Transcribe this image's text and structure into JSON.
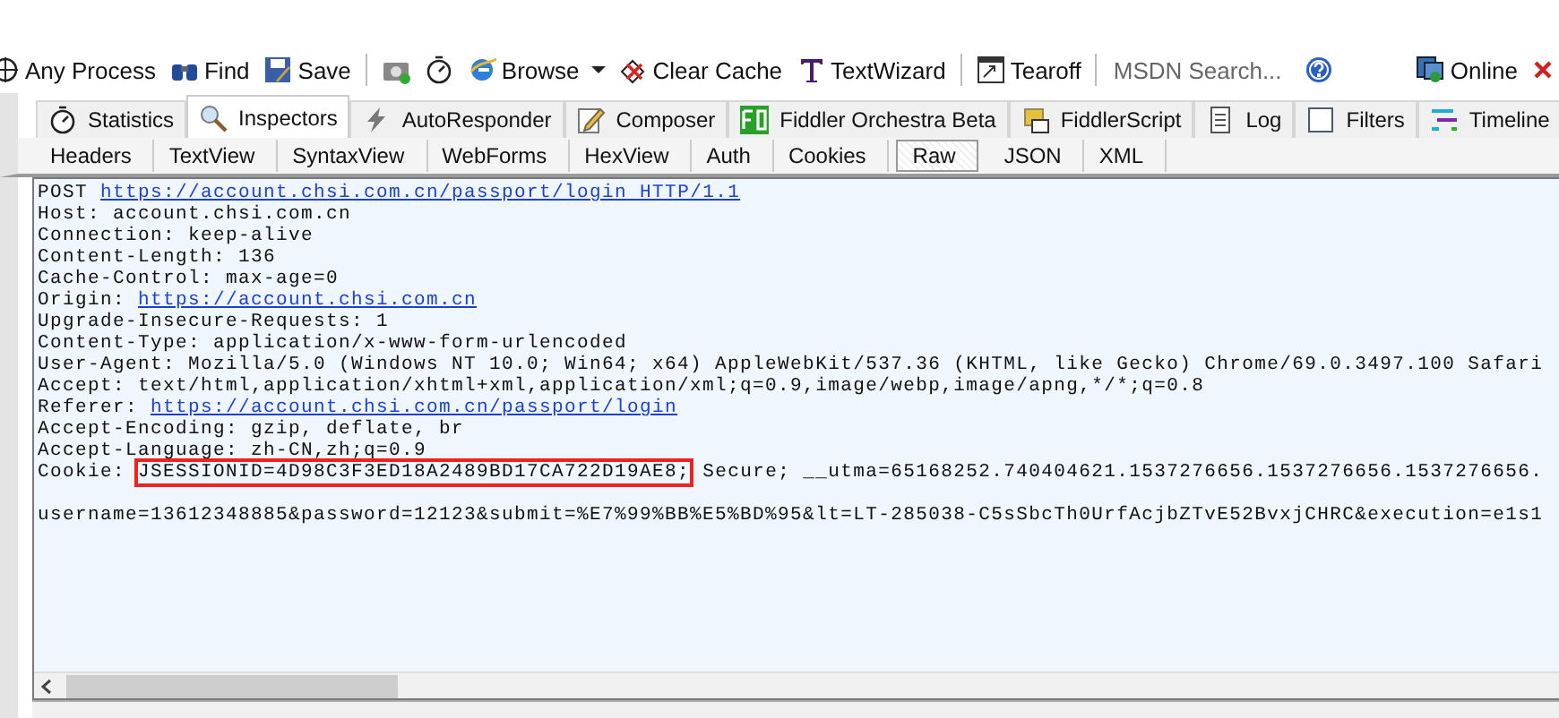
{
  "toolbar": {
    "items": [
      {
        "kind": "button",
        "label": "Any Process"
      },
      {
        "kind": "button",
        "label": "Find"
      },
      {
        "kind": "button",
        "label": "Save"
      },
      {
        "kind": "separator"
      },
      {
        "kind": "button"
      },
      {
        "kind": "button"
      },
      {
        "kind": "button",
        "label": "Browse"
      },
      {
        "kind": "dropdown"
      },
      {
        "kind": "button",
        "label": "Clear Cache"
      },
      {
        "kind": "button",
        "label": "TextWizard"
      },
      {
        "kind": "separator"
      },
      {
        "kind": "button",
        "label": "Tearoff"
      },
      {
        "kind": "separator"
      },
      {
        "kind": "search",
        "placeholder": "MSDN Search..."
      },
      {
        "kind": "button"
      },
      {
        "kind": "spacer"
      },
      {
        "kind": "button",
        "label": "Online"
      },
      {
        "kind": "close"
      }
    ]
  },
  "tabs": [
    {
      "label": "Statistics",
      "selected": false
    },
    {
      "label": "Inspectors",
      "selected": true
    },
    {
      "label": "AutoResponder",
      "selected": false
    },
    {
      "label": "Composer",
      "selected": false
    },
    {
      "label": "Fiddler Orchestra Beta",
      "selected": false
    },
    {
      "label": "FiddlerScript",
      "selected": false
    },
    {
      "label": "Log",
      "selected": false
    },
    {
      "label": "Filters",
      "selected": false
    },
    {
      "label": "Timeline",
      "selected": false
    }
  ],
  "inspector_tabs": [
    {
      "label": "Headers",
      "selected": false
    },
    {
      "label": "TextView",
      "selected": false
    },
    {
      "label": "SyntaxView",
      "selected": false
    },
    {
      "label": "WebForms",
      "selected": false
    },
    {
      "label": "HexView",
      "selected": false
    },
    {
      "label": "Auth",
      "selected": false
    },
    {
      "label": "Cookies",
      "selected": false
    },
    {
      "label": "Raw",
      "selected": true
    },
    {
      "label": "JSON",
      "selected": false
    },
    {
      "label": "XML",
      "selected": false
    }
  ],
  "raw_request": [
    {
      "kind": "line",
      "segments": [
        {
          "text": "POST ",
          "link": false
        },
        {
          "text": "https://account.chsi.com.cn/passport/login HTTP/1.1",
          "link": true
        }
      ]
    },
    {
      "kind": "line",
      "segments": [
        {
          "text": "Host: account.chsi.com.cn"
        }
      ]
    },
    {
      "kind": "line",
      "segments": [
        {
          "text": "Connection: keep-alive"
        }
      ]
    },
    {
      "kind": "line",
      "segments": [
        {
          "text": "Content-Length: 136"
        }
      ]
    },
    {
      "kind": "line",
      "segments": [
        {
          "text": "Cache-Control: max-age=0"
        }
      ]
    },
    {
      "kind": "line",
      "segments": [
        {
          "text": "Origin: ",
          "link": false
        },
        {
          "text": "https://account.chsi.com.cn",
          "link": true
        }
      ]
    },
    {
      "kind": "line",
      "segments": [
        {
          "text": "Upgrade-Insecure-Requests: 1"
        }
      ]
    },
    {
      "kind": "line",
      "segments": [
        {
          "text": "Content-Type: application/x-www-form-urlencoded"
        }
      ]
    },
    {
      "kind": "line",
      "segments": [
        {
          "text": "User-Agent: Mozilla/5.0 (Windows NT 10.0; Win64; x64) AppleWebKit/537.36 (KHTML, like Gecko) Chrome/69.0.3497.100 Safari"
        }
      ]
    },
    {
      "kind": "line",
      "segments": [
        {
          "text": "Accept: text/html,application/xhtml+xml,application/xml;q=0.9,image/webp,image/apng,*/*;q=0.8"
        }
      ]
    },
    {
      "kind": "line",
      "segments": [
        {
          "text": "Referer: ",
          "link": false
        },
        {
          "text": "https://account.chsi.com.cn/passport/login",
          "link": true
        }
      ]
    },
    {
      "kind": "line",
      "segments": [
        {
          "text": "Accept-Encoding: gzip, deflate, br"
        }
      ]
    },
    {
      "kind": "line",
      "segments": [
        {
          "text": "Accept-Language: zh-CN,zh;q=0.9"
        }
      ]
    },
    {
      "kind": "line",
      "segments": [
        {
          "text": "Cookie: ",
          "highlighted": false
        },
        {
          "text": "JSESSIONID=4D98C3F3ED18A2489BD17CA722D19AE8;",
          "highlighted": true
        },
        {
          "text": " Secure; __utma=65168252.740404621.1537276656.1537276656.1537276656.",
          "highlighted": false
        }
      ]
    },
    {
      "kind": "blank"
    },
    {
      "kind": "line",
      "segments": [
        {
          "text": "username=13612348885&password=12123&submit=%E7%99%BB%E5%BD%95&lt=LT-285038-C5sSbcTh0UrfAcjbZTvE52BvxjCHRC&execution=e1s1"
        }
      ]
    }
  ]
}
